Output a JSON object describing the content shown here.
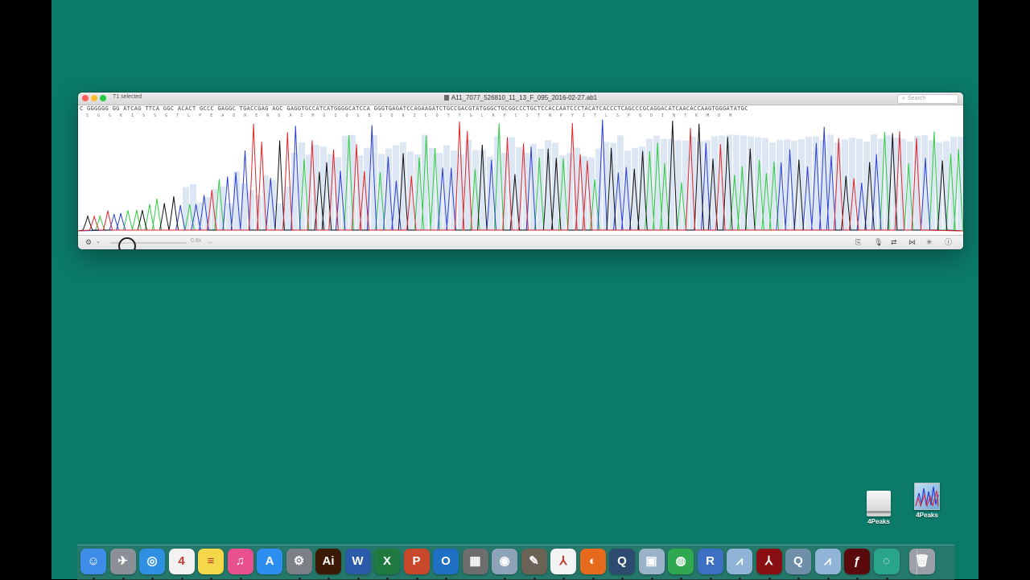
{
  "window": {
    "selection_label": "T1 selected",
    "title": "A11_7077_526810_11_13_F_095_2016-02-27.ab1",
    "search_placeholder": "Search",
    "sequence": "C GGGGGG GG ATCAG TTCA GGC ACACT GCCC GAGGC TGACCGAG AGC GAGGTGCCATCATGGGGCATCCA GGGTGAGATCCAGAAGATCTGCCGACGTATGGGCTGCGGCCCTGCTCCACCAATCCCTACATCACCCTCAGCCCGCAGGACATCAACACCAAGTGGGATATGC",
    "translation": "S G G K I S S G T L P E A D R E R G A I M G I Q G E I Q K I C Q T Y G L R P C S T N P Y I T L S P Q D I N T K M D M",
    "zoom_label": "0.8x",
    "colors": {
      "A": "#2ecc40",
      "C": "#2a3fd6",
      "G": "#111111",
      "T": "#e0262b",
      "quality": "#dde6f3"
    }
  },
  "desktop": {
    "icons": [
      {
        "label": "4Peaks",
        "kind": "drive"
      },
      {
        "label": "4Peaks",
        "kind": "app"
      }
    ]
  },
  "dock": {
    "apps": [
      {
        "name": "Finder",
        "glyph": "☺",
        "color": "#3d8de8"
      },
      {
        "name": "Launchpad",
        "glyph": "✈",
        "color": "#8a8f98"
      },
      {
        "name": "Safari",
        "glyph": "◎",
        "color": "#2f8fe0"
      },
      {
        "name": "Calendar",
        "glyph": "4",
        "color": "#f2f2f2"
      },
      {
        "name": "Notes",
        "glyph": "≡",
        "color": "#f5d74a"
      },
      {
        "name": "iTunes",
        "glyph": "♫",
        "color": "#e9508f"
      },
      {
        "name": "App Store",
        "glyph": "A",
        "color": "#2b8ef0"
      },
      {
        "name": "System Preferences",
        "glyph": "⚙",
        "color": "#7b7f86"
      },
      {
        "name": "Illustrator",
        "glyph": "Ai",
        "color": "#3b1a05"
      },
      {
        "name": "Word",
        "glyph": "W",
        "color": "#2a5ba8"
      },
      {
        "name": "Excel",
        "glyph": "X",
        "color": "#1f7a3f"
      },
      {
        "name": "PowerPoint",
        "glyph": "P",
        "color": "#c9472b"
      },
      {
        "name": "Outlook",
        "glyph": "O",
        "color": "#1f6fc4"
      },
      {
        "name": "Calculator",
        "glyph": "▦",
        "color": "#6d6d6d"
      },
      {
        "name": "Disk Utility",
        "glyph": "◉",
        "color": "#8fa3b8"
      },
      {
        "name": "GIMP",
        "glyph": "✎",
        "color": "#6b6256"
      },
      {
        "name": "Acrobat Reader",
        "glyph": "⅄",
        "color": "#f3f3f3"
      },
      {
        "name": "Firefox",
        "glyph": "◐",
        "color": "#e66a1c"
      },
      {
        "name": "QuickTime",
        "glyph": "Q",
        "color": "#2d4b70"
      },
      {
        "name": "Preview",
        "glyph": "▣",
        "color": "#9ab3c9"
      },
      {
        "name": "Chrome",
        "glyph": "◍",
        "color": "#2fa84f"
      },
      {
        "name": "R",
        "glyph": "R",
        "color": "#3d6fc2"
      },
      {
        "name": "4Peaks",
        "glyph": "⩘",
        "color": "#8fb4d8"
      },
      {
        "name": "Acrobat",
        "glyph": "⅄",
        "color": "#8a0f12"
      },
      {
        "name": "Quinn",
        "glyph": "Q",
        "color": "#6f8fa8"
      },
      {
        "name": "4Peaks 2",
        "glyph": "⩘",
        "color": "#8fb4d8"
      },
      {
        "name": "Flash",
        "glyph": "ƒ",
        "color": "#5a0a0a"
      },
      {
        "name": "Canopy",
        "glyph": "◌",
        "color": "#2aa58c"
      },
      {
        "name": "Trash",
        "glyph": "🗑",
        "color": "#9aa0a6"
      }
    ]
  }
}
